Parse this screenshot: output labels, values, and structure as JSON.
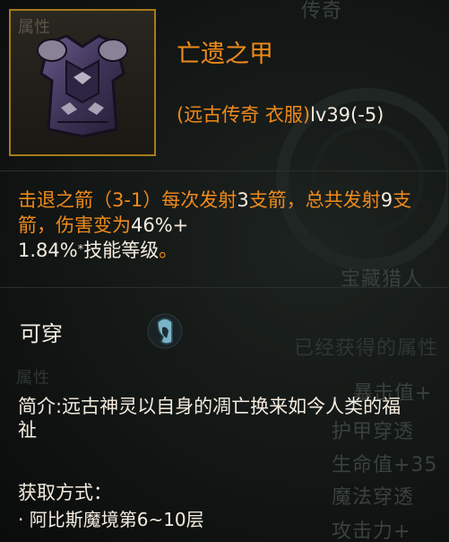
{
  "item": {
    "name": "亡遗之甲",
    "type_label": "(远古传奇 衣服)",
    "level_label": "lv39(-5)",
    "slot_ghost_label": "属性",
    "icon": "dark-armor-chestplate-icon"
  },
  "skill": {
    "part1": "击退之箭（3-1）每次发射",
    "num1": "3",
    "part2": "支箭，总共发射",
    "num2": "9",
    "part3": "支箭，伤害变为",
    "num3": "46%+",
    "line3_num": "1.84%",
    "line3_star": "*",
    "line3_text": "技能等级",
    "line3_end": "。"
  },
  "wearable": {
    "label": "可穿",
    "icon": "hood-icon"
  },
  "description": {
    "text": "简介:远古神灵以自身的凋亡换来如今人类的福祉"
  },
  "obtain": {
    "title": "获取方式：",
    "items": [
      "· 阿比斯魔境第6~10层"
    ]
  },
  "background_text": {
    "top": "传奇",
    "treasure": "宝藏猎人",
    "acquired": "已经获得的属性",
    "attr_ghost": "属性",
    "stat1": "暴击值+",
    "stat2": "护甲穿透",
    "stat3": "生命值+35",
    "stat4": "魔法穿透",
    "stat5": "攻击力+"
  },
  "colors": {
    "orange": "#f08a1a",
    "white": "#f4ece0",
    "frame": "#a77a1c"
  }
}
